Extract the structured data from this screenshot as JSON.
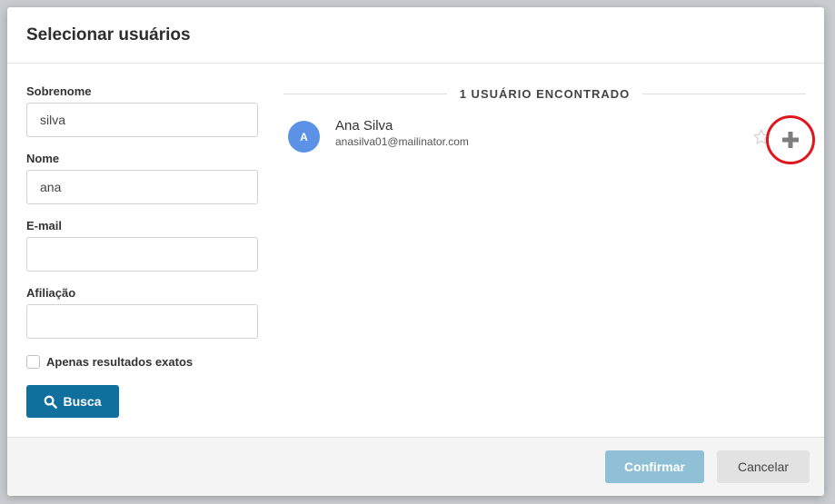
{
  "modal": {
    "title": "Selecionar usuários"
  },
  "form": {
    "surname": {
      "label": "Sobrenome",
      "value": "silva"
    },
    "name": {
      "label": "Nome",
      "value": "ana"
    },
    "email": {
      "label": "E-mail",
      "value": ""
    },
    "affiliation": {
      "label": "Afiliação",
      "value": ""
    },
    "exact_only": {
      "label": "Apenas resultados exatos",
      "checked": false
    },
    "search_label": "Busca"
  },
  "results": {
    "count_label": "1 USUÁRIO ENCONTRADO",
    "users": [
      {
        "initial": "A",
        "name": "Ana Silva",
        "email": "anasilva01@mailinator.com"
      }
    ]
  },
  "footer": {
    "confirm_label": "Confirmar",
    "cancel_label": "Cancelar"
  },
  "colors": {
    "primary": "#0f6f9d",
    "primary_disabled": "#8fc0d6",
    "avatar": "#5b92e5",
    "highlight_circle": "#e0161d"
  },
  "icons": {
    "search": "search-icon",
    "favorite": "star-outline-icon",
    "add": "plus-icon"
  }
}
